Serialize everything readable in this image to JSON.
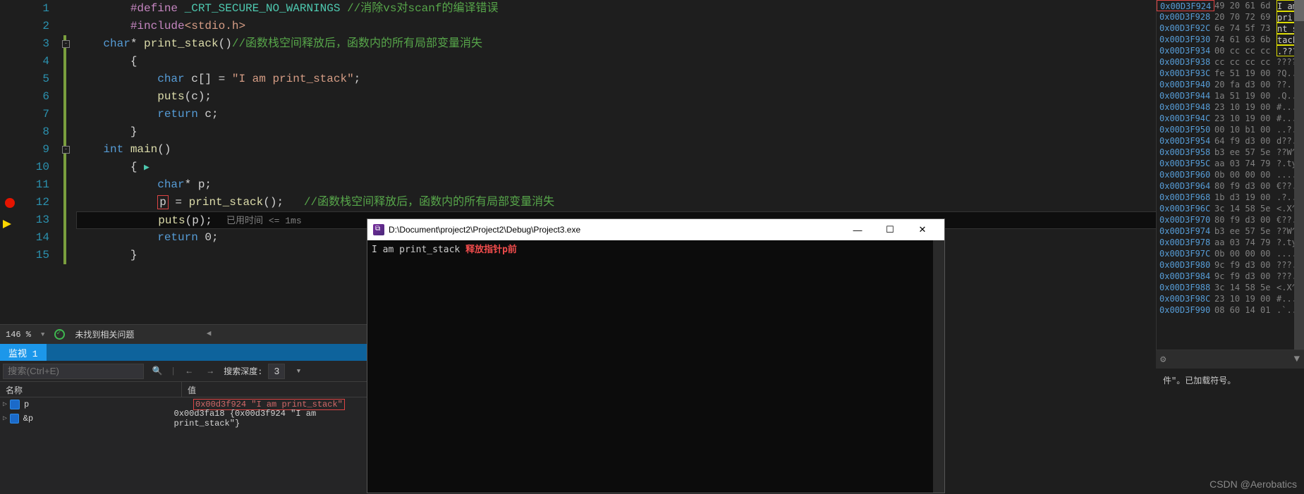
{
  "code": {
    "lines": [
      {
        "n": "1",
        "indent": "        ",
        "tokens": [
          {
            "t": "#define ",
            "c": "k-purple"
          },
          {
            "t": "_CRT_SECURE_NO_WARNINGS",
            "c": "k-cyan"
          },
          {
            "t": " //消除vs对scanf的编译错误",
            "c": "k-comment"
          }
        ]
      },
      {
        "n": "2",
        "indent": "        ",
        "tokens": [
          {
            "t": "#include",
            "c": "k-purple"
          },
          {
            "t": "<stdio.h>",
            "c": "k-str"
          }
        ]
      },
      {
        "n": "3",
        "indent": "    ",
        "fold": "-",
        "mark": true,
        "tokens": [
          {
            "t": "char",
            "c": "k-blue"
          },
          {
            "t": "* ",
            "c": "k-white"
          },
          {
            "t": "print_stack",
            "c": "k-func"
          },
          {
            "t": "()",
            "c": "k-white"
          },
          {
            "t": "//函数栈空间释放后，函数内的所有局部变量消失",
            "c": "k-comment"
          }
        ]
      },
      {
        "n": "4",
        "indent": "        ",
        "mark": true,
        "tokens": [
          {
            "t": "{",
            "c": "k-white"
          }
        ]
      },
      {
        "n": "5",
        "indent": "            ",
        "mark": true,
        "tokens": [
          {
            "t": "char",
            "c": "k-blue"
          },
          {
            "t": " c[] = ",
            "c": "k-white"
          },
          {
            "t": "\"I am print_stack\"",
            "c": "k-str"
          },
          {
            "t": ";",
            "c": "k-white"
          }
        ]
      },
      {
        "n": "6",
        "indent": "            ",
        "mark": true,
        "tokens": [
          {
            "t": "puts",
            "c": "k-func"
          },
          {
            "t": "(c);",
            "c": "k-white"
          }
        ]
      },
      {
        "n": "7",
        "indent": "            ",
        "mark": true,
        "tokens": [
          {
            "t": "return",
            "c": "k-blue"
          },
          {
            "t": " c;",
            "c": "k-white"
          }
        ]
      },
      {
        "n": "8",
        "indent": "        ",
        "mark": true,
        "tokens": [
          {
            "t": "}",
            "c": "k-white"
          }
        ]
      },
      {
        "n": "9",
        "indent": "    ",
        "fold": "-",
        "mark": true,
        "tokens": [
          {
            "t": "int",
            "c": "k-blue"
          },
          {
            "t": " ",
            "c": "k-white"
          },
          {
            "t": "main",
            "c": "k-func"
          },
          {
            "t": "()",
            "c": "k-white"
          }
        ]
      },
      {
        "n": "10",
        "indent": "        ",
        "mark": true,
        "tokens": [
          {
            "t": "{ ",
            "c": "k-white"
          },
          {
            "t": "▶",
            "c": "play-icon"
          }
        ]
      },
      {
        "n": "11",
        "indent": "            ",
        "mark": true,
        "tokens": [
          {
            "t": "char",
            "c": "k-blue"
          },
          {
            "t": "* p;",
            "c": "k-white"
          }
        ]
      },
      {
        "n": "12",
        "indent": "            ",
        "mark": true,
        "bp": true,
        "tokens": [
          {
            "t": "p",
            "c": "k-white box-p"
          },
          {
            "t": " = ",
            "c": "k-white"
          },
          {
            "t": "print_stack",
            "c": "k-func"
          },
          {
            "t": "();   ",
            "c": "k-white"
          },
          {
            "t": "//函数栈空间释放后，函数内的所有局部变量消失",
            "c": "k-comment"
          }
        ]
      },
      {
        "n": "13",
        "indent": "            ",
        "mark": true,
        "cur": true,
        "arrow": true,
        "tokens": [
          {
            "t": "puts",
            "c": "k-func"
          },
          {
            "t": "(p);",
            "c": "k-white"
          }
        ],
        "hint": "已用时间 <= 1ms"
      },
      {
        "n": "14",
        "indent": "            ",
        "mark": true,
        "tokens": [
          {
            "t": "return",
            "c": "k-blue"
          },
          {
            "t": " 0;",
            "c": "k-white"
          }
        ]
      },
      {
        "n": "15",
        "indent": "        ",
        "mark": true,
        "tokens": [
          {
            "t": "}",
            "c": "k-white"
          }
        ]
      }
    ]
  },
  "status": {
    "zoom": "146 %",
    "dropdown": "▼",
    "issues": "未找到相关问题",
    "divider": "◀"
  },
  "watch": {
    "tab_label": "监视 1",
    "search_placeholder": "搜索(Ctrl+E)",
    "search_icon": "🔍",
    "nav_left": "←",
    "nav_right": "→",
    "depth_label": "搜索深度:",
    "depth_value": "3",
    "col_name": "名称",
    "col_value": "值",
    "rows": [
      {
        "name": "p",
        "value": "0x00d3f924 \"I am print_stack\"",
        "hl": true
      },
      {
        "name": "&p",
        "value": "0x00d3fa18 {0x00d3f924 \"I am print_stack\"}",
        "hl": false
      }
    ]
  },
  "console": {
    "title": "D:\\Document\\project2\\Project2\\Debug\\Project3.exe",
    "line1_a": "I am print_stack",
    "line1_b": "释放指针p前",
    "btn_min": "—",
    "btn_max": "☐",
    "btn_close": "✕"
  },
  "memory": {
    "rows": [
      {
        "addr": "0x00D3F924",
        "hex": "49 20 61 6d",
        "asc": "I am",
        "addr_hl": true,
        "asc_hl": true
      },
      {
        "addr": "0x00D3F928",
        "hex": "20 70 72 69",
        "asc": " pri",
        "asc_hl": true
      },
      {
        "addr": "0x00D3F92C",
        "hex": "6e 74 5f 73",
        "asc": "nt_s",
        "asc_hl": true
      },
      {
        "addr": "0x00D3F930",
        "hex": "74 61 63 6b",
        "asc": "tack",
        "asc_hl": true
      },
      {
        "addr": "0x00D3F934",
        "hex": "00 cc cc cc",
        "asc": ".???",
        "asc_hl": true
      },
      {
        "addr": "0x00D3F938",
        "hex": "cc cc cc cc",
        "asc": "????"
      },
      {
        "addr": "0x00D3F93C",
        "hex": "fe 51 19 00",
        "asc": "?Q.."
      },
      {
        "addr": "0x00D3F940",
        "hex": "20 fa d3 00",
        "asc": " ??."
      },
      {
        "addr": "0x00D3F944",
        "hex": "1a 51 19 00",
        "asc": ".Q.."
      },
      {
        "addr": "0x00D3F948",
        "hex": "23 10 19 00",
        "asc": "#..."
      },
      {
        "addr": "0x00D3F94C",
        "hex": "23 10 19 00",
        "asc": "#..."
      },
      {
        "addr": "0x00D3F950",
        "hex": "00 10 b1 00",
        "asc": "..?."
      },
      {
        "addr": "0x00D3F954",
        "hex": "64 f9 d3 00",
        "asc": "d??."
      },
      {
        "addr": "0x00D3F958",
        "hex": "b3 ee 57 5e",
        "asc": "??W^"
      },
      {
        "addr": "0x00D3F95C",
        "hex": "aa 03 74 79",
        "asc": "?.ty"
      },
      {
        "addr": "0x00D3F960",
        "hex": "0b 00 00 00",
        "asc": "...."
      },
      {
        "addr": "0x00D3F964",
        "hex": "80 f9 d3 00",
        "asc": "€??."
      },
      {
        "addr": "0x00D3F968",
        "hex": "1b d3 19 00",
        "asc": ".?.."
      },
      {
        "addr": "0x00D3F96C",
        "hex": "3c 14 58 5e",
        "asc": "<.X^"
      },
      {
        "addr": "0x00D3F970",
        "hex": "80 f9 d3 00",
        "asc": "€??."
      },
      {
        "addr": "0x00D3F974",
        "hex": "b3 ee 57 5e",
        "asc": "??W^"
      },
      {
        "addr": "0x00D3F978",
        "hex": "aa 03 74 79",
        "asc": "?.ty"
      },
      {
        "addr": "0x00D3F97C",
        "hex": "0b 00 00 00",
        "asc": "...."
      },
      {
        "addr": "0x00D3F980",
        "hex": "9c f9 d3 00",
        "asc": "???."
      },
      {
        "addr": "0x00D3F984",
        "hex": "9c f9 d3 00",
        "asc": "???."
      },
      {
        "addr": "0x00D3F988",
        "hex": "3c 14 58 5e",
        "asc": "<.X^"
      },
      {
        "addr": "0x00D3F98C",
        "hex": "23 10 19 00",
        "asc": "#..."
      },
      {
        "addr": "0x00D3F990",
        "hex": "08 60 14 01",
        "asc": ".`..`"
      }
    ]
  },
  "right_bottom": {
    "text": "件\"。已加载符号。"
  },
  "watermark": "CSDN @Aerobatics"
}
